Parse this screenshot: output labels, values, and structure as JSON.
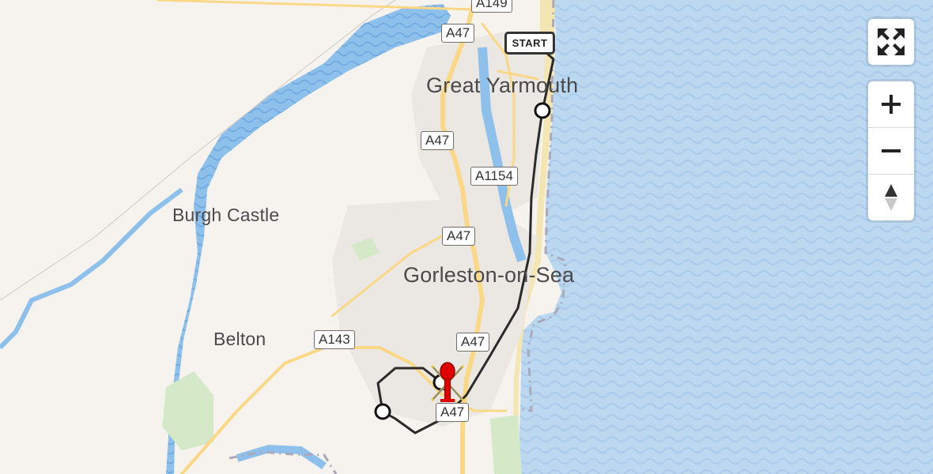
{
  "map": {
    "places": [
      {
        "name": "Great Yarmouth",
        "size": "big"
      },
      {
        "name": "Gorleston-on-Sea",
        "size": "big"
      },
      {
        "name": "Burgh Castle",
        "size": "med"
      },
      {
        "name": "Belton",
        "size": "med"
      }
    ],
    "roads": [
      "A149",
      "A47",
      "A47",
      "A1154",
      "A47",
      "A143",
      "A47",
      "A47"
    ],
    "route": {
      "start_label": "START"
    },
    "colors": {
      "sea": "#bcd7f0",
      "land": "#f6f3ef",
      "river": "#8ec0ec",
      "roads": "#fbd885",
      "route": "#2b2b2b",
      "marker": "#e10000"
    }
  },
  "controls": {
    "fullscreen_icon": "expand-arrows-icon",
    "zoom_in_icon": "plus-icon",
    "zoom_out_icon": "minus-icon",
    "compass_icon": "north-arrow-icon"
  }
}
